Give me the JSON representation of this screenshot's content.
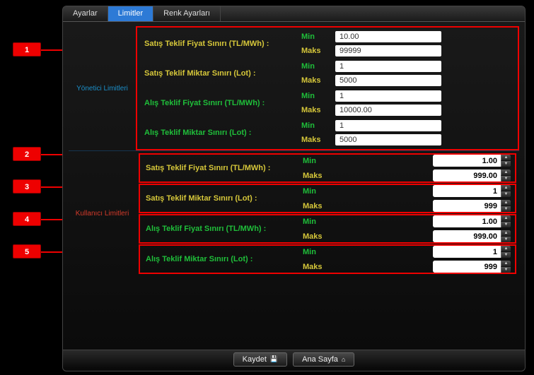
{
  "tabs": {
    "settings": "Ayarlar",
    "limits": "Limitler",
    "colors": "Renk Ayarları"
  },
  "admin": {
    "title": "Yönetici Limitleri",
    "rows": {
      "sell_price": {
        "label": "Satış Teklif Fiyat Sınırı (TL/MWh) :",
        "min_label": "Min",
        "max_label": "Maks",
        "min": "10.00",
        "max": "99999"
      },
      "sell_qty": {
        "label": "Satış Teklif Miktar Sınırı (Lot) :",
        "min_label": "Min",
        "max_label": "Maks",
        "min": "1",
        "max": "5000"
      },
      "buy_price": {
        "label": "Alış Teklif Fiyat Sınırı (TL/MWh) :",
        "min_label": "Min",
        "max_label": "Maks",
        "min": "1",
        "max": "10000.00"
      },
      "buy_qty": {
        "label": "Alış Teklif Miktar Sınırı (Lot) :",
        "min_label": "Min",
        "max_label": "Maks",
        "min": "1",
        "max": "5000"
      }
    }
  },
  "user": {
    "title": "Kullanıcı Limitleri",
    "rows": {
      "sell_price": {
        "label": "Satış Teklif Fiyat Sınırı (TL/MWh) :",
        "min_label": "Min",
        "max_label": "Maks",
        "min": "1.00",
        "max": "999.00"
      },
      "sell_qty": {
        "label": "Satış Teklif Miktar Sınırı (Lot) :",
        "min_label": "Min",
        "max_label": "Maks",
        "min": "1",
        "max": "999"
      },
      "buy_price": {
        "label": "Alış Teklif Fiyat Sınırı (TL/MWh) :",
        "min_label": "Min",
        "max_label": "Maks",
        "min": "1.00",
        "max": "999.00"
      },
      "buy_qty": {
        "label": "Alış Teklif Miktar Sınırı (Lot) :",
        "min_label": "Min",
        "max_label": "Maks",
        "min": "1",
        "max": "999"
      }
    }
  },
  "footer": {
    "save": "Kaydet",
    "home": "Ana Sayfa"
  },
  "callouts": [
    "1",
    "2",
    "3",
    "4",
    "5"
  ]
}
